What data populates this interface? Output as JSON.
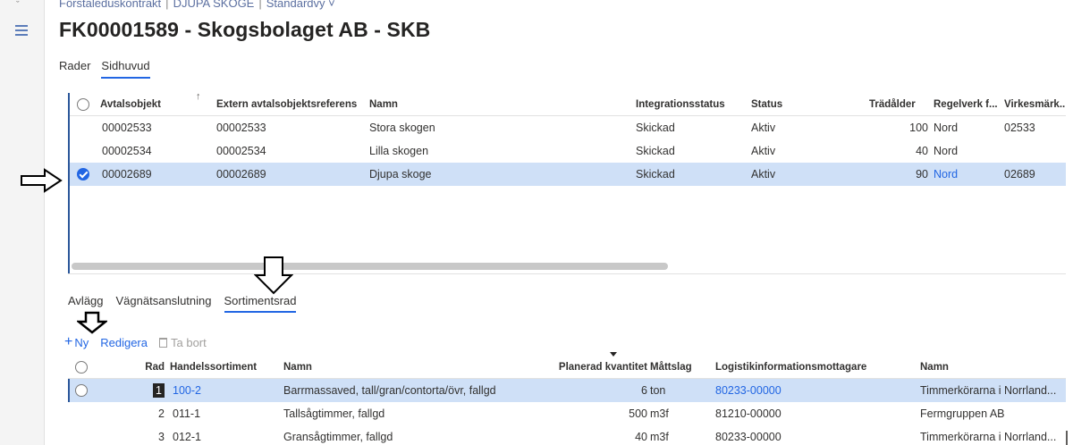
{
  "breadcrumb": {
    "item1": "Förstaleduskontrakt",
    "item2": "DJUPA SKOGE",
    "item3": "Standardvy",
    "sep": "|",
    "caret": "˅"
  },
  "page_title": "FK00001589 - Skogsbolaget AB - SKB",
  "tabs": [
    "Rader",
    "Sidhuvud"
  ],
  "grid1": {
    "headers": [
      "Avtalsobjekt",
      "Extern avtalsobjektsreferens",
      "Namn",
      "Integrationsstatus",
      "Status",
      "Trädålder",
      "Regelverk f...",
      "Virkesmärk..."
    ],
    "sort_icon": "↑",
    "rows": [
      {
        "objekt": "00002533",
        "extern": "00002533",
        "namn": "Stora skogen",
        "integ": "Skickad",
        "status": "Aktiv",
        "alder": "100",
        "regelverk": "Nord",
        "virke": "02533",
        "selected": false
      },
      {
        "objekt": "00002534",
        "extern": "00002534",
        "namn": "Lilla skogen",
        "integ": "Skickad",
        "status": "Aktiv",
        "alder": "40",
        "regelverk": "Nord",
        "virke": "",
        "selected": false
      },
      {
        "objekt": "00002689",
        "extern": "00002689",
        "namn": "Djupa skoge",
        "integ": "Skickad",
        "status": "Aktiv",
        "alder": "90",
        "regelverk": "Nord",
        "virke": "02689",
        "selected": true
      }
    ]
  },
  "subtabs": [
    "Avlägg",
    "Vägnätsanslutning",
    "Sortimentsrad"
  ],
  "toolbar": {
    "new_label": "Ny",
    "edit_label": "Redigera",
    "delete_label": "Ta bort"
  },
  "grid2": {
    "headers": [
      "Rad",
      "Handelssortiment",
      "Namn",
      "Planerad kvantitet",
      "Måttslag",
      "Logistikinformationsmottagare",
      "Namn"
    ],
    "rows": [
      {
        "rad": "1",
        "sortiment": "100-2",
        "namn": "Barrmassaved, tall/gran/contorta/övr, fallgd",
        "kvant": "6",
        "matt": "ton",
        "mott": "80233-00000",
        "mottnamn": "Timmerkörarna i Norrland..."
      },
      {
        "rad": "2",
        "sortiment": "011-1",
        "namn": "Tallsågtimmer, fallgd",
        "kvant": "500",
        "matt": "m3f",
        "mott": "81210-00000",
        "mottnamn": "Fermgruppen AB"
      },
      {
        "rad": "3",
        "sortiment": "012-1",
        "namn": "Gransågtimmer, fallgd",
        "kvant": "40",
        "matt": "m3f",
        "mott": "80233-00000",
        "mottnamn": "Timmerkörarna i Norrland..."
      }
    ]
  },
  "colors": {
    "accent": "#2266e3",
    "selected_row": "#cfe0f7",
    "title": "#252423"
  },
  "icons": [
    "hamburger-menu-icon",
    "sort-ascending-icon",
    "radio-checked-icon",
    "plus-icon",
    "trash-icon",
    "pointer-arrow-icon"
  ]
}
